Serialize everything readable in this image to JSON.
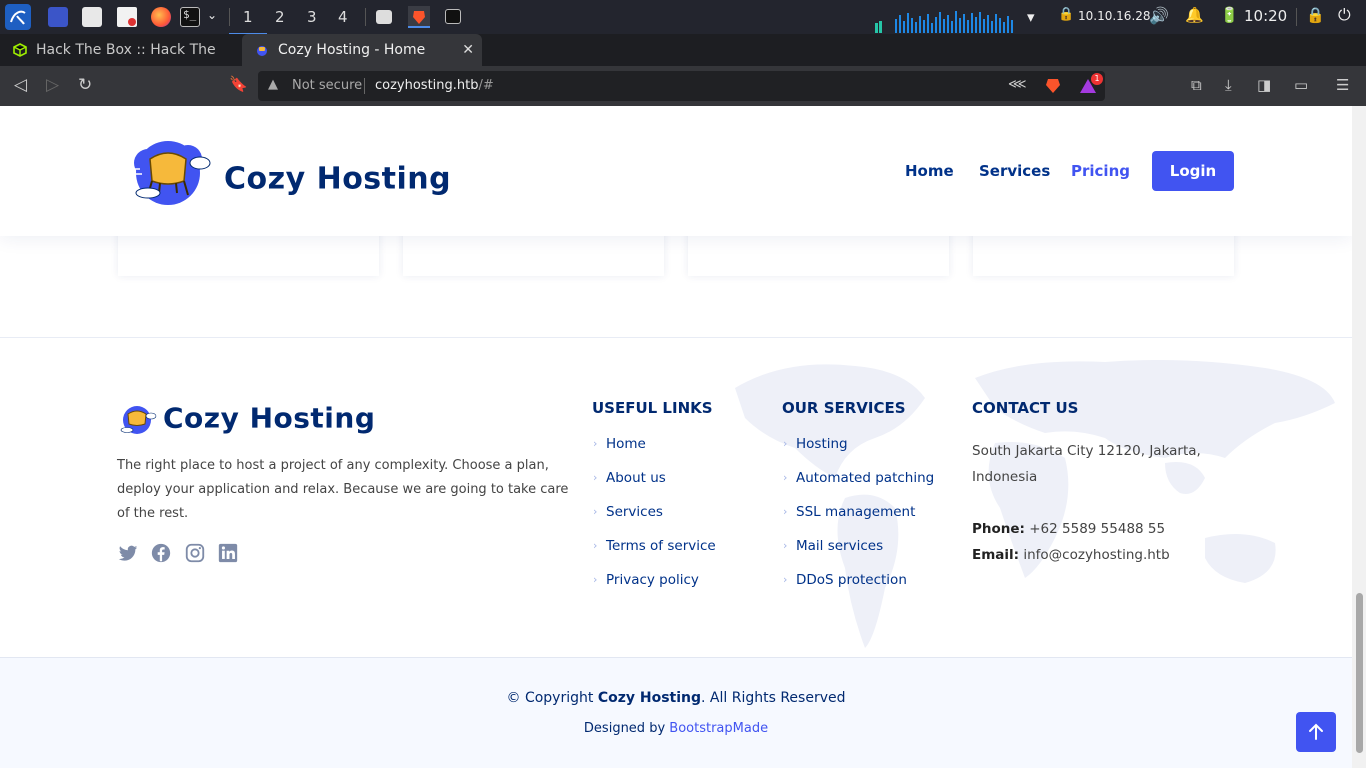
{
  "taskbar": {
    "workspaces": [
      "1",
      "2",
      "3",
      "4"
    ],
    "ip": "10.10.16.28",
    "clock": "10:20",
    "accent": "#4d8be8"
  },
  "browser": {
    "tabs": [
      {
        "label": "Hack The Box :: Hack The Box",
        "icon": "hackthebox-icon"
      },
      {
        "label": "Cozy Hosting - Home",
        "icon": "cozy-hosting-favicon"
      }
    ],
    "address": {
      "security": "Not secure",
      "url_host": "cozyhosting.htb",
      "url_path": "/#"
    },
    "shield_badge": "1"
  },
  "site": {
    "brand": "Cozy Hosting",
    "nav": {
      "home": "Home",
      "services": "Services",
      "pricing": "Pricing",
      "login": "Login"
    },
    "colors": {
      "primary": "#4154f1",
      "navy": "#012970"
    }
  },
  "footer": {
    "brand": "Cozy Hosting",
    "description": "The right place to host a project of any complexity. Choose a plan, deploy your application and relax. Because we are going to take care of the rest.",
    "social": [
      "twitter-icon",
      "facebook-icon",
      "instagram-icon",
      "linkedin-icon"
    ],
    "useful_links": {
      "title": "Useful Links",
      "items": [
        "Home",
        "About us",
        "Services",
        "Terms of service",
        "Privacy policy"
      ]
    },
    "our_services": {
      "title": "Our Services",
      "items": [
        "Hosting",
        "Automated patching",
        "SSL management",
        "Mail services",
        "DDoS protection"
      ]
    },
    "contact": {
      "title": "Contact Us",
      "address": "South Jakarta City 12120, Jakarta, Indonesia",
      "phone_label": "Phone:",
      "phone": "+62 5589 55488 55",
      "email_label": "Email:",
      "email": "info@cozyhosting.htb"
    },
    "copyright_prefix": "© Copyright",
    "copyright_brand": "Cozy Hosting",
    "copyright_suffix": ". All Rights Reserved",
    "designed_by": "Designed by",
    "designer": "BootstrapMade"
  }
}
